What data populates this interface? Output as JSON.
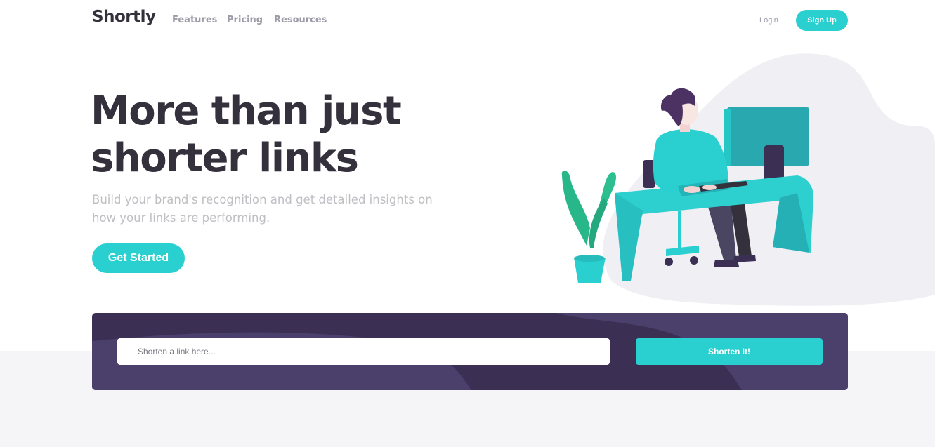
{
  "nav": {
    "logo": "Shortly",
    "links": [
      "Features",
      "Pricing",
      "Resources"
    ],
    "login": "Login",
    "signup": "Sign Up"
  },
  "hero": {
    "headline_line1": "More than just",
    "headline_line2": "shorter links",
    "subtext": "Build your brand's recognition and get detailed insights on how your links are performing.",
    "cta": "Get Started"
  },
  "shorten": {
    "placeholder": "Shorten a link here...",
    "button": "Shorten It!"
  },
  "colors": {
    "primary": "#2acfcf",
    "dark_violet": "#3b3054",
    "dark_text": "#34313d",
    "gray_text": "#bfbfc4",
    "nav_gray": "#9e9aa8",
    "light_bg": "#f5f5f7"
  },
  "icons": [
    "working-person-illustration"
  ]
}
